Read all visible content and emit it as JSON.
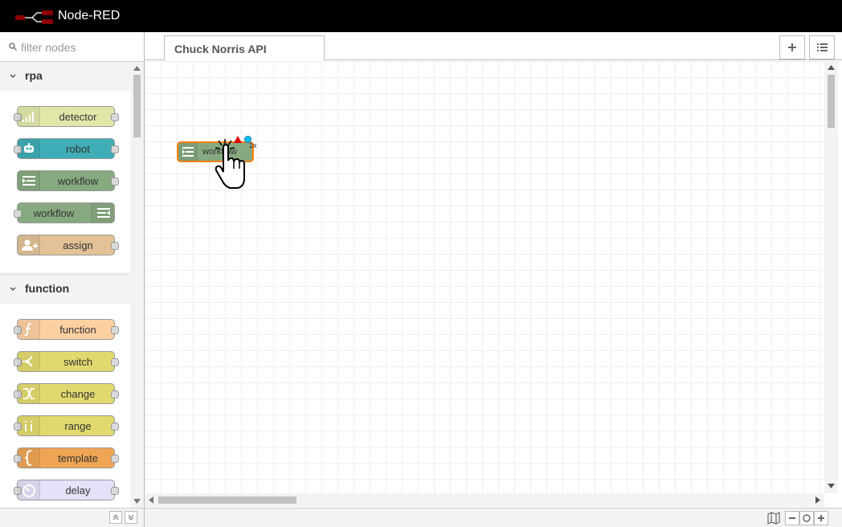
{
  "header": {
    "title": "Node-RED"
  },
  "palette": {
    "search_placeholder": "filter nodes",
    "categories": [
      {
        "label": "rpa",
        "nodes": [
          {
            "label": "detector",
            "color": "#e2e7a9",
            "icon": "signal-bars-icon"
          },
          {
            "label": "robot",
            "color": "#3fadb5",
            "icon": "robot-icon"
          },
          {
            "label": "workflow",
            "color": "#87a980",
            "icon": "workflow-icon"
          },
          {
            "label": "workflow",
            "color": "#87a980",
            "icon": "workflow-icon"
          },
          {
            "label": "assign",
            "color": "#e2c296",
            "icon": "add-user-icon"
          }
        ]
      },
      {
        "label": "function",
        "nodes": [
          {
            "label": "function",
            "color": "#fdd0a2",
            "icon": "function-icon"
          },
          {
            "label": "switch",
            "color": "#e2d96e",
            "icon": "switch-icon"
          },
          {
            "label": "change",
            "color": "#e2d96e",
            "icon": "shuffle-icon"
          },
          {
            "label": "range",
            "color": "#e2d96e",
            "icon": "range-icon"
          },
          {
            "label": "template",
            "color": "#f0a554",
            "icon": "braces-icon"
          },
          {
            "label": "delay",
            "color": "#e6e0f8",
            "icon": "timer-icon"
          }
        ]
      }
    ]
  },
  "workspace": {
    "tabs": [
      {
        "label": "Chuck Norris API"
      }
    ],
    "flow_nodes": [
      {
        "label": "workflow",
        "color": "#87a980",
        "selected_border": "#ff7f0e",
        "badge": "2x"
      }
    ]
  }
}
